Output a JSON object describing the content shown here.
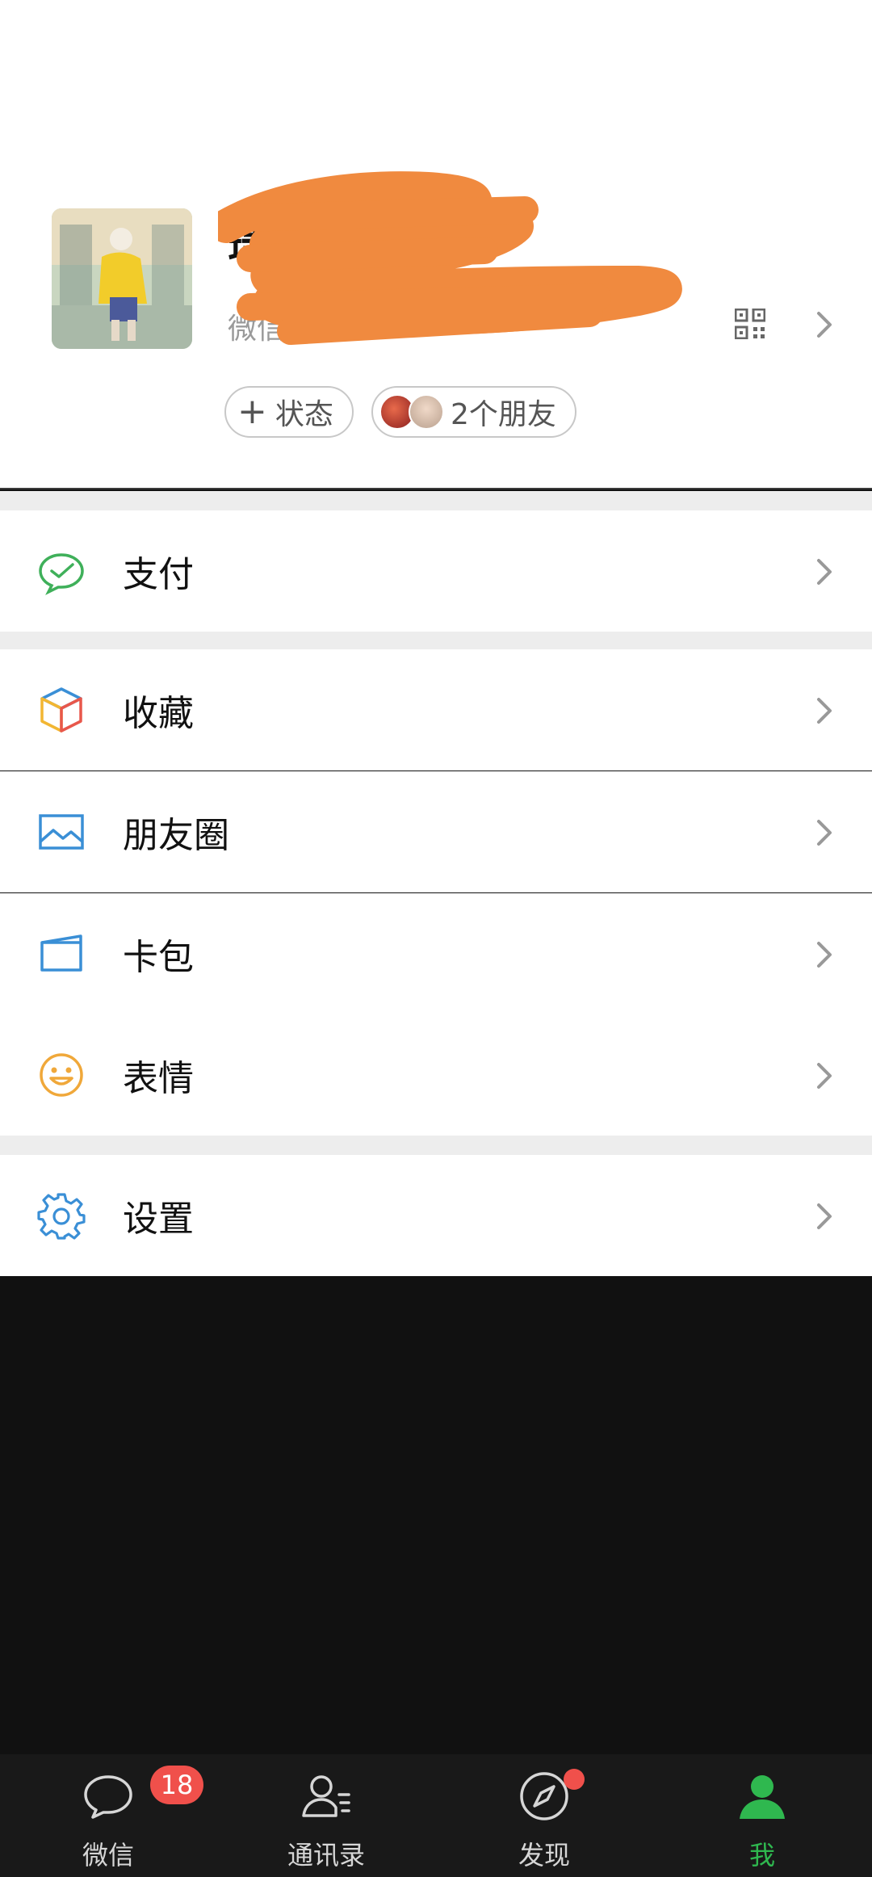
{
  "profile": {
    "name": "瑞",
    "wechat_id_label": "微信号",
    "status_button": "状态",
    "friends_button": "2个朋友"
  },
  "menu": {
    "pay": "支付",
    "favorites": "收藏",
    "moments": "朋友圈",
    "cards": "卡包",
    "stickers": "表情",
    "settings": "设置"
  },
  "tabs": [
    {
      "label": "微信",
      "icon": "chat-bubble-icon",
      "badge": "18"
    },
    {
      "label": "通讯录",
      "icon": "contacts-icon"
    },
    {
      "label": "发现",
      "icon": "compass-icon",
      "dot": true
    },
    {
      "label": "我",
      "icon": "person-icon",
      "active": true
    }
  ],
  "colors": {
    "accent_green": "#2fb84f",
    "badge_red": "#f0504b",
    "redaction_orange": "#f08a3f"
  }
}
